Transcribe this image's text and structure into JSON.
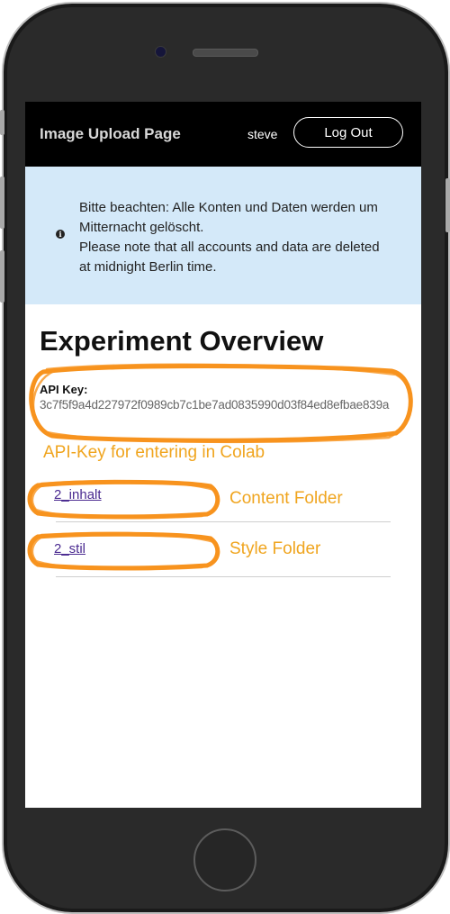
{
  "header": {
    "title": "Image Upload Page",
    "username": "steve",
    "logout_label": "Log Out"
  },
  "notice": {
    "icon": "info-icon",
    "line1": "Bitte beachten: Alle Konten und Daten werden um Mitternacht gelöscht.",
    "line2": "Please note that all accounts and data are deleted at midnight Berlin time."
  },
  "main": {
    "title": "Experiment Overview",
    "api_key_label": "API Key:",
    "api_key_value": "3c7f5f9a4d227972f0989cb7c1be7ad0835990d03f84ed8efbae839a",
    "folders": [
      {
        "name": "2_inhalt"
      },
      {
        "name": "2_stil"
      }
    ]
  },
  "annotations": {
    "api_key_note": "API-Key for entering in Colab",
    "content_note": "Content Folder",
    "style_note": "Style Folder",
    "highlight_color": "#f7931e",
    "text_color": "#f0a51f"
  }
}
